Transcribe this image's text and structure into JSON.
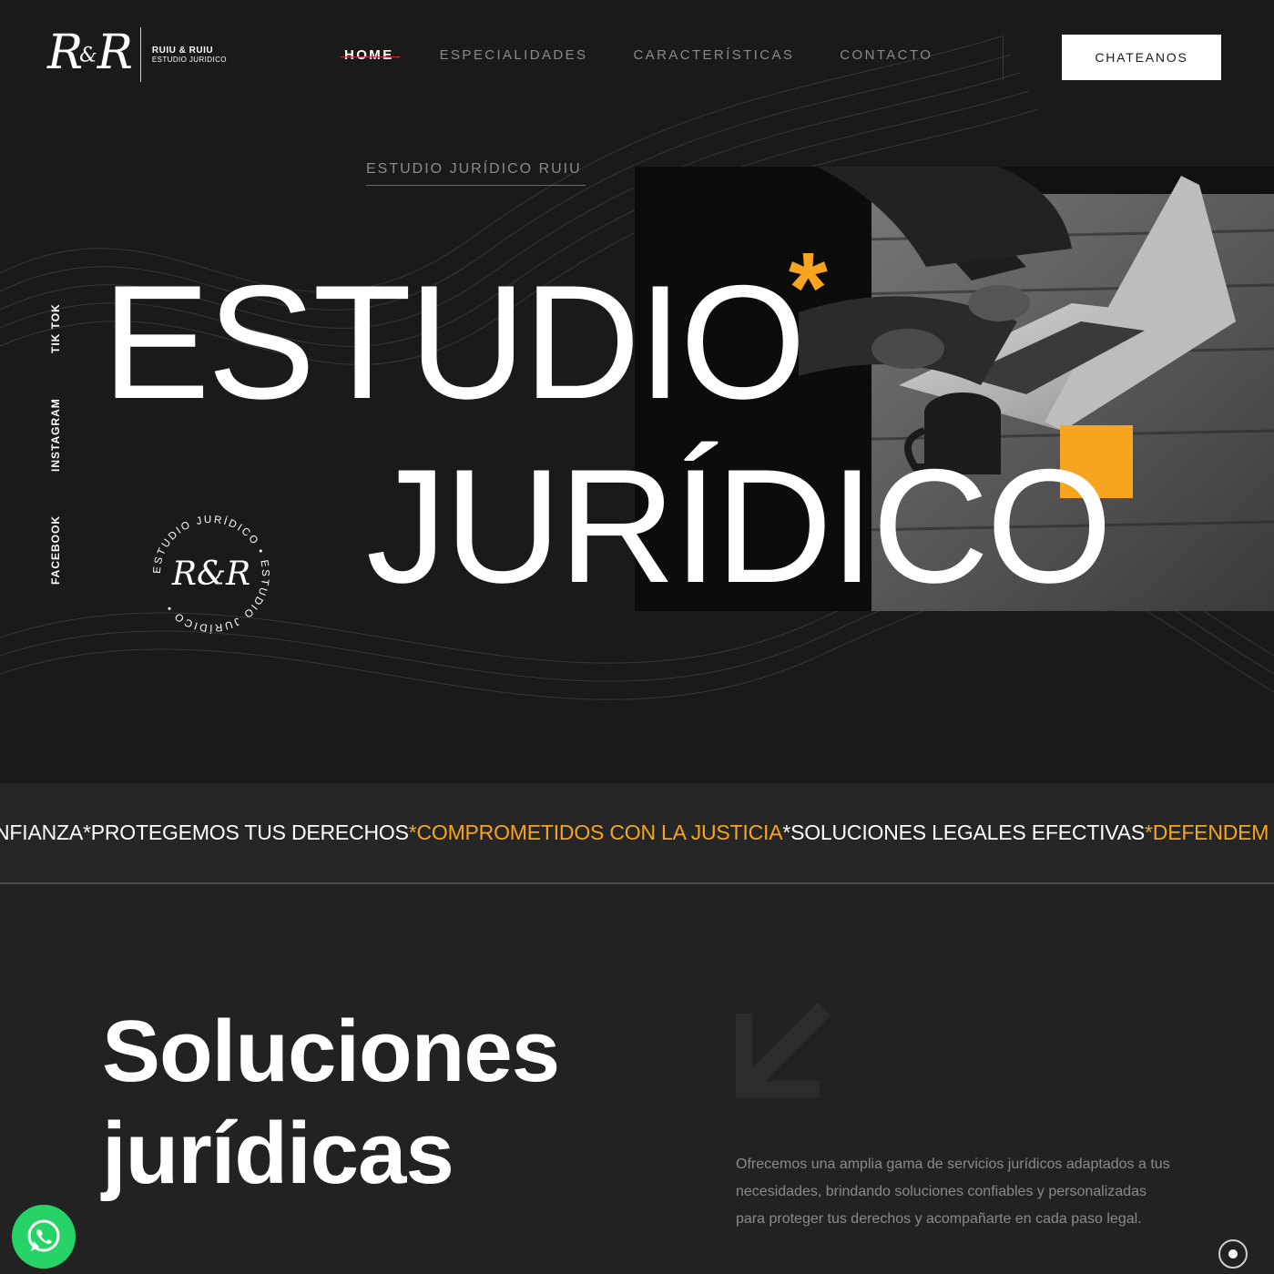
{
  "header": {
    "logo_mark_left": "R",
    "logo_mark_amp": "&",
    "logo_mark_right": "R",
    "logo_line1": "RUIU & RUIU",
    "logo_line2": "ESTUDIO JURIDICO",
    "nav": [
      "HOME",
      "ESPECIALIDADES",
      "CARACTERÍSTICAS",
      "CONTACTO"
    ],
    "active_nav": "HOME",
    "cta_label": "CHATEANOS"
  },
  "hero": {
    "eyebrow": "ESTUDIO JURÍDICO RUIU",
    "title_line1": "ESTUDIO",
    "title_line2": "JURÍDICO",
    "asterisk": "*",
    "socials": [
      "TIK TOK",
      "INSTAGRAM",
      "FACEBOOK"
    ],
    "seal_text": "ESTUDIO JURÍDICO • ESTUDIO JURÍDICO •",
    "seal_monogram": "R&R"
  },
  "marquee": {
    "items": [
      {
        "text": "NFIANZA",
        "color": "white"
      },
      {
        "text": "*PROTEGEMOS TUS DERECHOS",
        "color": "white"
      },
      {
        "text": "*COMPROMETIDOS CON LA JUSTICIA",
        "color": "orange"
      },
      {
        "text": "*SOLUCIONES LEGALES EFECTIVAS",
        "color": "white"
      },
      {
        "text": "*DEFENDEM",
        "color": "orange"
      }
    ]
  },
  "solutions": {
    "title_line1": "Soluciones",
    "title_line2": "jurídicas",
    "description": "Ofrecemos una amplia gama de servicios jurídicos adaptados a tus necesidades, brindando soluciones confiables y personalizadas para proteger tus derechos y acompañarte en cada paso legal."
  },
  "colors": {
    "background": "#1a1a1a",
    "accent": "#f7a51e",
    "whatsapp": "#25d366",
    "nav_active_underline": "#d7263d"
  },
  "icons": [
    "whatsapp-icon",
    "arrow-down-left-icon",
    "scroll-indicator-icon"
  ]
}
